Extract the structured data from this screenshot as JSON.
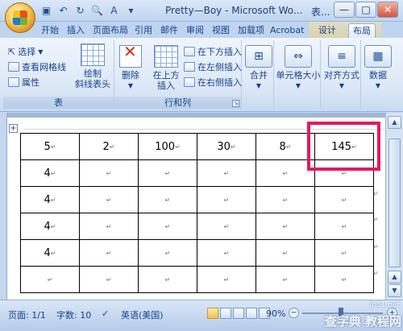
{
  "window": {
    "title": "Pretty—Boy - Microsoft Wo...",
    "context_label": "表...",
    "controls": [
      "—",
      "□",
      "✕"
    ]
  },
  "quick_access": [
    "save-icon",
    "undo-icon",
    "redo-icon",
    "print-preview-icon",
    "format-icon"
  ],
  "tabs": [
    "开始",
    "插入",
    "页面布局",
    "引用",
    "邮件",
    "审阅",
    "视图",
    "加载项",
    "Acrobat",
    "设计",
    "布局"
  ],
  "active_tab": "布局",
  "ribbon": {
    "table_group": {
      "label": "表",
      "select": "选择",
      "gridlines": "查看网格线",
      "properties": "属性",
      "draw_diagonal": "绘制\n斜线表头"
    },
    "rows_cols_group": {
      "label": "行和列",
      "delete": "删除",
      "insert_above": "在上方\n插入",
      "insert_below": "在下方插入",
      "insert_left": "在左侧插入",
      "insert_right": "在右侧插入"
    },
    "merge": "合并",
    "cell_size": "单元格大小",
    "alignment": "对齐方式",
    "data": "数据"
  },
  "table": {
    "rows": [
      [
        "5",
        "2",
        "100",
        "30",
        "8",
        "145"
      ],
      [
        "4",
        "",
        "",
        "",
        "",
        ""
      ],
      [
        "4",
        "",
        "",
        "",
        "",
        ""
      ],
      [
        "4",
        "",
        "",
        "",
        "",
        ""
      ],
      [
        "4",
        "",
        "",
        "",
        "",
        ""
      ],
      [
        "",
        "",
        "",
        "",
        "",
        ""
      ]
    ],
    "cell_mark": "↵"
  },
  "status": {
    "page": "页面: 1/1",
    "words": "字数: 10",
    "language": "英语(美国)",
    "zoom": "90%"
  },
  "watermark": {
    "site": "jb51.net",
    "text": "查字典 教程网"
  },
  "colors": {
    "highlight": "#e8185a",
    "ribbon_text": "#15428b"
  }
}
